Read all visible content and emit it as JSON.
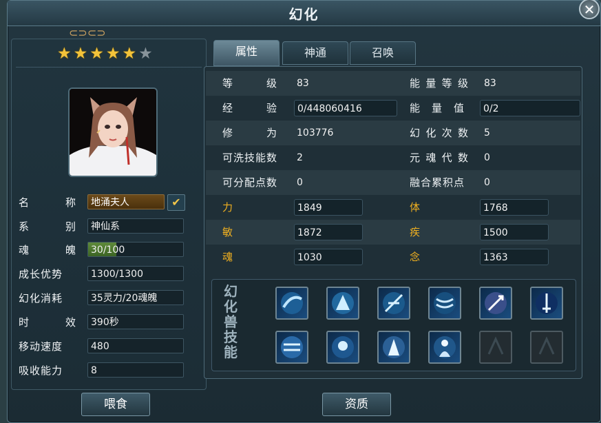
{
  "window": {
    "title": "幻化"
  },
  "stars": {
    "filled": 5,
    "total": 6
  },
  "left": {
    "name": {
      "label_a": "名",
      "label_b": "称",
      "value": "地涌夫人"
    },
    "series": {
      "label_a": "系",
      "label_b": "别",
      "value": "神仙系"
    },
    "soul": {
      "label_a": "魂",
      "label_b": "魄",
      "value": "30/100",
      "fraction": 0.3
    },
    "growth": {
      "label": "成长优势",
      "value": "1300/1300"
    },
    "cost": {
      "label": "幻化消耗",
      "value": "35灵力/20魂魄"
    },
    "duration": {
      "label_a": "时",
      "label_b": "效",
      "value": "390秒"
    },
    "speed": {
      "label": "移动速度",
      "value": "480"
    },
    "absorb": {
      "label": "吸收能力",
      "value": "8"
    }
  },
  "tabs": [
    {
      "label": "属性"
    },
    {
      "label": "神通"
    },
    {
      "label": "召唤"
    }
  ],
  "attrs": {
    "level": {
      "label_a": "等",
      "label_b": "级",
      "value": "83"
    },
    "exp": {
      "label_a": "经",
      "label_b": "验",
      "value": "0/448060416"
    },
    "cultivation": {
      "label_a": "修",
      "label_b": "为",
      "value": "103776"
    },
    "washable": {
      "label": "可洗技能数",
      "value": "2"
    },
    "assignable": {
      "label": "可分配点数",
      "value": "0"
    },
    "str": {
      "label": "力",
      "value": "1849"
    },
    "agi": {
      "label": "敏",
      "value": "1872"
    },
    "soul": {
      "label": "魂",
      "value": "1030"
    },
    "energy_level": {
      "label_a": "能",
      "label_b": "量",
      "label_c": "等",
      "label_d": "级",
      "value": "83"
    },
    "energy": {
      "label_a": "能",
      "label_b": "量",
      "label_c": "值",
      "value": "0/2"
    },
    "transform_count": {
      "label_a": "幻",
      "label_b": "化",
      "label_c": "次",
      "label_d": "数",
      "value": "5"
    },
    "soul_gen": {
      "label_a": "元",
      "label_b": "魂",
      "label_c": "代",
      "label_d": "数",
      "value": "0"
    },
    "fusion": {
      "label": "融合累积点",
      "value": "0"
    },
    "con": {
      "label": "体",
      "value": "1768"
    },
    "haste": {
      "label": "疾",
      "value": "1500"
    },
    "mind": {
      "label": "念",
      "value": "1363"
    }
  },
  "skills": {
    "label": "幻化兽技能",
    "icons": [
      "skill-1-icon",
      "skill-2-icon",
      "skill-3-icon",
      "skill-4-icon",
      "skill-5-icon",
      "skill-6-icon",
      "skill-7-icon",
      "skill-8-icon",
      "skill-9-icon",
      "skill-10-icon"
    ],
    "empty_slots": 2
  },
  "buttons": {
    "feed": "喂食",
    "aptitude": "资质"
  },
  "colors": {
    "gold": "#f0b020",
    "accent": "#6d8a98"
  }
}
